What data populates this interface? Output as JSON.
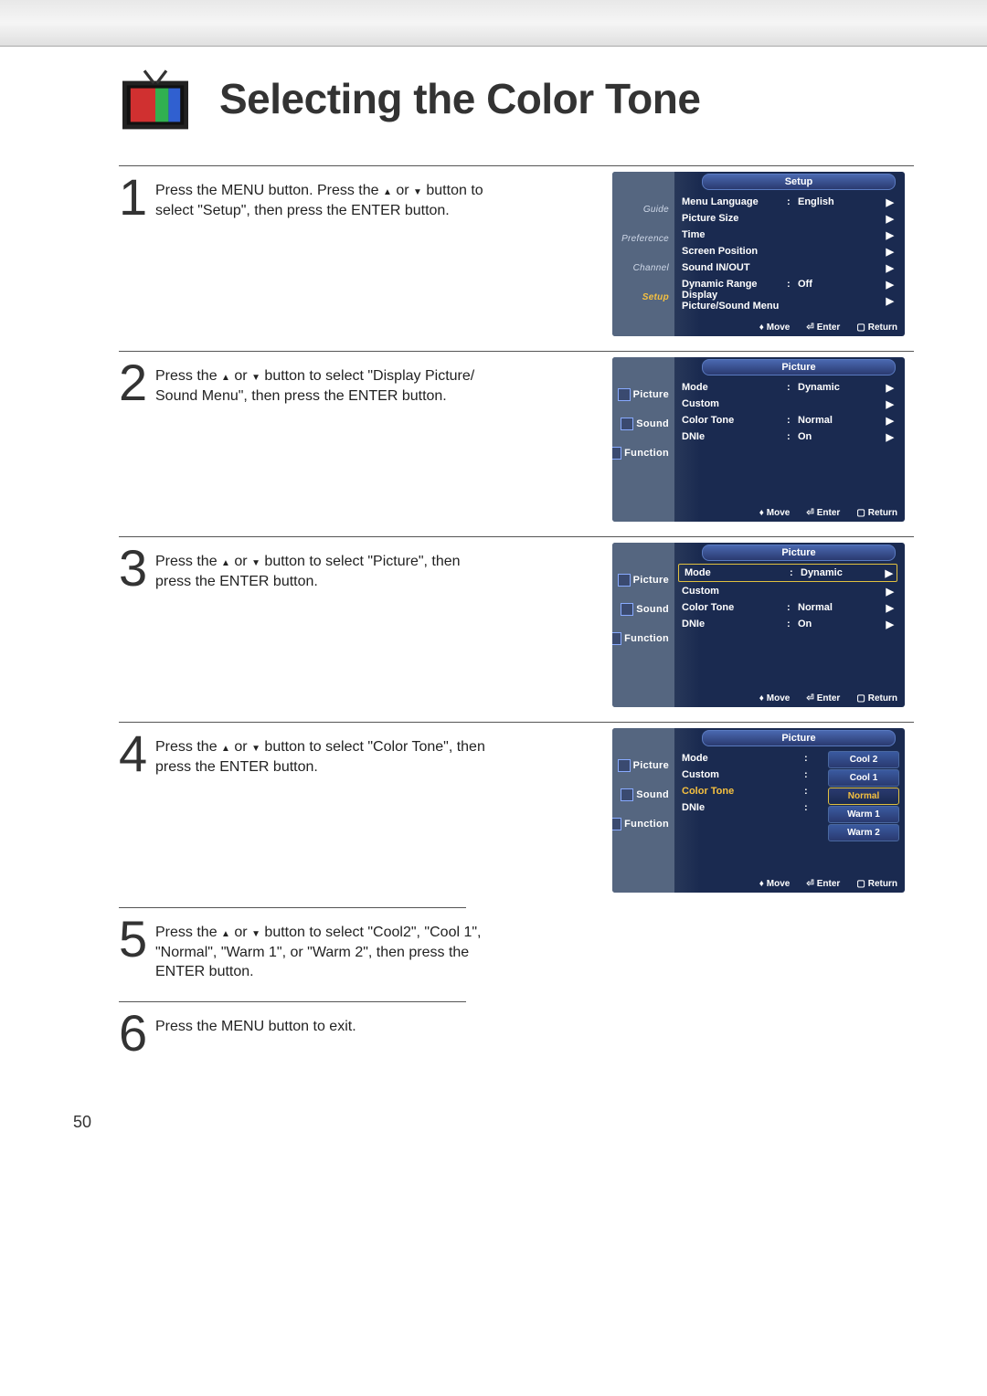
{
  "title": "Selecting the Color Tone",
  "page_number": "50",
  "arrow_up": "▲",
  "arrow_down": "▼",
  "arrow_right": "▶",
  "arrow_updown": "♦",
  "enter_glyph": "⏎",
  "return_glyph": "▢",
  "footer": {
    "move": "Move",
    "enter": "Enter",
    "return": "Return"
  },
  "steps": [
    {
      "num": "1",
      "text_a": "Press the MENU button. Press the ",
      "text_b": " or ",
      "text_c": " button to select \"Setup\", then press the ENTER button.",
      "osd": {
        "tv": "TV",
        "title": "Setup",
        "side_style": "script",
        "side": [
          "Guide",
          "Preference",
          "Channel",
          "Setup"
        ],
        "side_active": 3,
        "items": [
          {
            "label": "Menu Language",
            "value": "English",
            "arrow": true
          },
          {
            "label": "Picture Size",
            "value": "",
            "arrow": true
          },
          {
            "label": "Time",
            "value": "",
            "arrow": true
          },
          {
            "label": "Screen Position",
            "value": "",
            "arrow": true
          },
          {
            "label": "Sound IN/OUT",
            "value": "",
            "arrow": true
          },
          {
            "label": "Dynamic Range",
            "value": "Off",
            "arrow": true
          },
          {
            "label": "Display Picture/Sound Menu",
            "value": "",
            "arrow": true
          }
        ]
      }
    },
    {
      "num": "2",
      "text_a": "Press the ",
      "text_b": " or ",
      "text_c": " button to select \"Display Picture/ Sound Menu\", then press the ENTER button.",
      "osd": {
        "tv": "TV",
        "title": "Picture",
        "side_style": "plain",
        "side": [
          "Picture",
          "Sound",
          "Function"
        ],
        "side_active": 0,
        "items": [
          {
            "label": "Mode",
            "value": "Dynamic",
            "arrow": true
          },
          {
            "label": "Custom",
            "value": "",
            "arrow": true
          },
          {
            "label": "Color Tone",
            "value": "Normal",
            "arrow": true
          },
          {
            "label": "DNIe",
            "value": "On",
            "arrow": true
          }
        ]
      }
    },
    {
      "num": "3",
      "text_a": "Press the ",
      "text_b": " or ",
      "text_c": " button to select \"Picture\", then press the ENTER button.",
      "osd": {
        "tv": "TV",
        "title": "Picture",
        "side_style": "plain",
        "side": [
          "Picture",
          "Sound",
          "Function"
        ],
        "side_active": 0,
        "boxed_item": 0,
        "items": [
          {
            "label": "Mode",
            "value": "Dynamic",
            "arrow": true
          },
          {
            "label": "Custom",
            "value": "",
            "arrow": true
          },
          {
            "label": "Color Tone",
            "value": "Normal",
            "arrow": true
          },
          {
            "label": "DNIe",
            "value": "On",
            "arrow": true
          }
        ]
      }
    },
    {
      "num": "4",
      "text_a": "Press the ",
      "text_b": " or ",
      "text_c": " button to select \"Color Tone\", then press the ENTER button.",
      "osd": {
        "tv": "TV",
        "title": "Picture",
        "side_style": "plain",
        "side": [
          "Picture",
          "Sound",
          "Function"
        ],
        "side_active": 0,
        "highlight_item": 2,
        "options_mode": true,
        "items": [
          {
            "label": "Mode"
          },
          {
            "label": "Custom"
          },
          {
            "label": "Color Tone"
          },
          {
            "label": "DNIe"
          }
        ],
        "options": [
          "Cool 2",
          "Cool 1",
          "Normal",
          "Warm 1",
          "Warm 2"
        ],
        "option_selected": 2
      }
    },
    {
      "num": "5",
      "text_a": "Press the ",
      "text_b": " or ",
      "text_c": " button to select \"Cool2\", \"Cool 1\", \"Normal\", \"Warm 1\", or \"Warm 2\", then press the ENTER button."
    },
    {
      "num": "6",
      "text_a": "Press the MENU button to exit.",
      "text_b": "",
      "text_c": ""
    }
  ]
}
